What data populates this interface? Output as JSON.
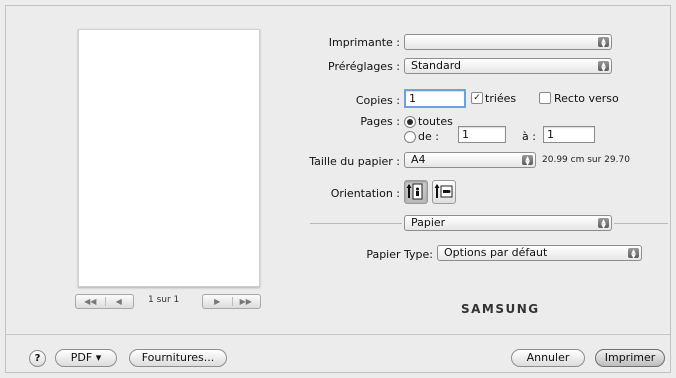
{
  "preview": {
    "nav_first": "◀◀",
    "nav_prev": "◀",
    "page_info": "1 sur 1",
    "nav_next": "▶",
    "nav_last": "▶▶"
  },
  "form": {
    "printer_label": "Imprimante :",
    "printer_value": "",
    "presets_label": "Préréglages :",
    "presets_value": "Standard",
    "copies_label": "Copies :",
    "copies_value": "1",
    "collated_label": "triées",
    "collated_checked": true,
    "duplex_label": "Recto verso",
    "duplex_checked": false,
    "pages_label": "Pages :",
    "pages_all_label": "toutes",
    "pages_from_label": "de :",
    "pages_from_value": "1",
    "pages_to_label": "à :",
    "pages_to_value": "1",
    "paper_size_label": "Taille du papier :",
    "paper_size_value": "A4",
    "paper_size_dims": "20.99 cm sur 29.70",
    "orientation_label": "Orientation :",
    "orientation_selected": "portrait",
    "section_value": "Papier",
    "paper_type_label": "Papier Type:",
    "paper_type_value": "Options par défaut"
  },
  "brand": "SAMSUNG",
  "footer": {
    "help": "?",
    "pdf": "PDF ▾",
    "supplies": "Fournitures...",
    "cancel": "Annuler",
    "print": "Imprimer"
  },
  "icons": {
    "popup_arrows": "▲▼"
  }
}
